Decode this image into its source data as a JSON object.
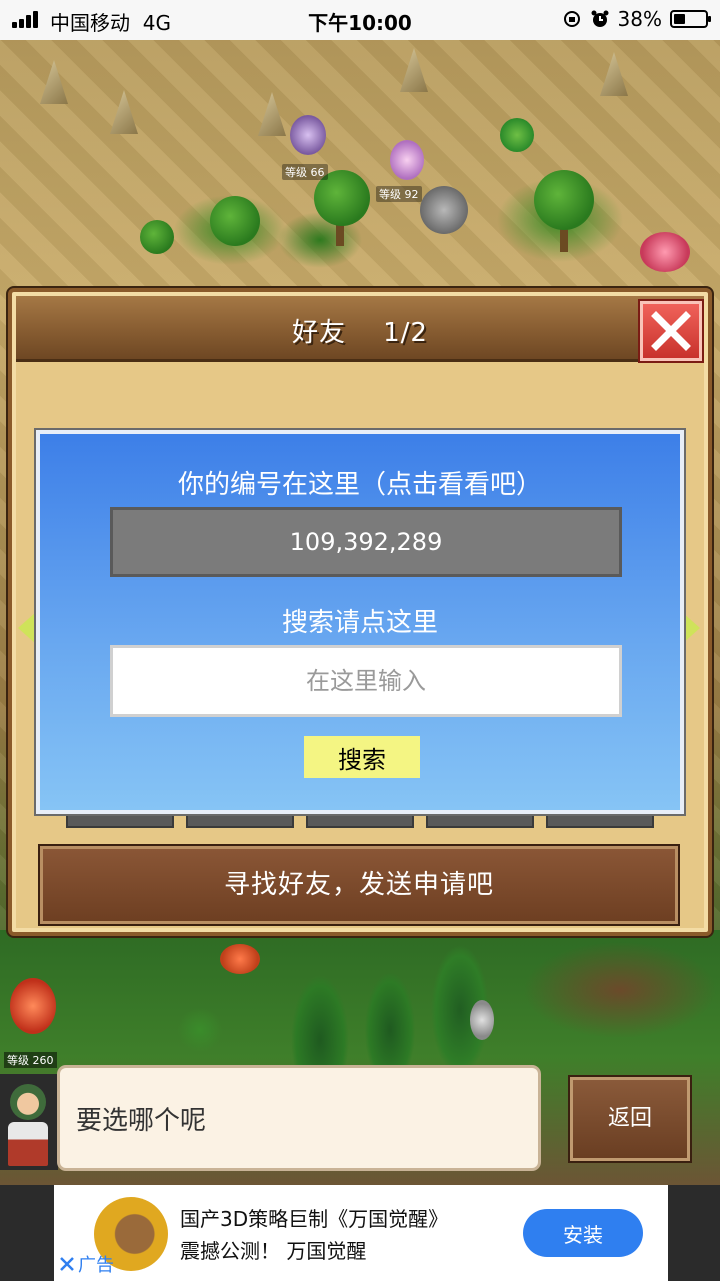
{
  "status_bar": {
    "carrier": "中国移动",
    "network": "4G",
    "time": "下午10:00",
    "battery": "38%",
    "battery_level": 0.38
  },
  "game": {
    "unit_levels": [
      "等级 66",
      "等级 92",
      "等级 260"
    ]
  },
  "friends_panel": {
    "title": "好友",
    "page": "1/2"
  },
  "id_dialog": {
    "id_caption": "你的编号在这里（点击看看吧）",
    "player_id": "109,392,289",
    "search_caption": "搜索请点这里",
    "search_placeholder": "在这里输入",
    "search_button": "搜索"
  },
  "find_friends_label": "寻找好友，发送申请吧",
  "dialogue": {
    "text": "要选哪个呢",
    "back_button": "返回"
  },
  "ad": {
    "line1": "国产3D策略巨制《万国觉醒》",
    "line2": "震撼公测！ 万国觉醒",
    "install_button": "安装",
    "ad_label": "广告"
  },
  "colors": {
    "dialog_blue": "#3d7fe8",
    "search_button": "#f4f583",
    "close_red": "#e24a42",
    "install_blue": "#2f7ff0",
    "panel_brown": "#8a5a2a"
  }
}
